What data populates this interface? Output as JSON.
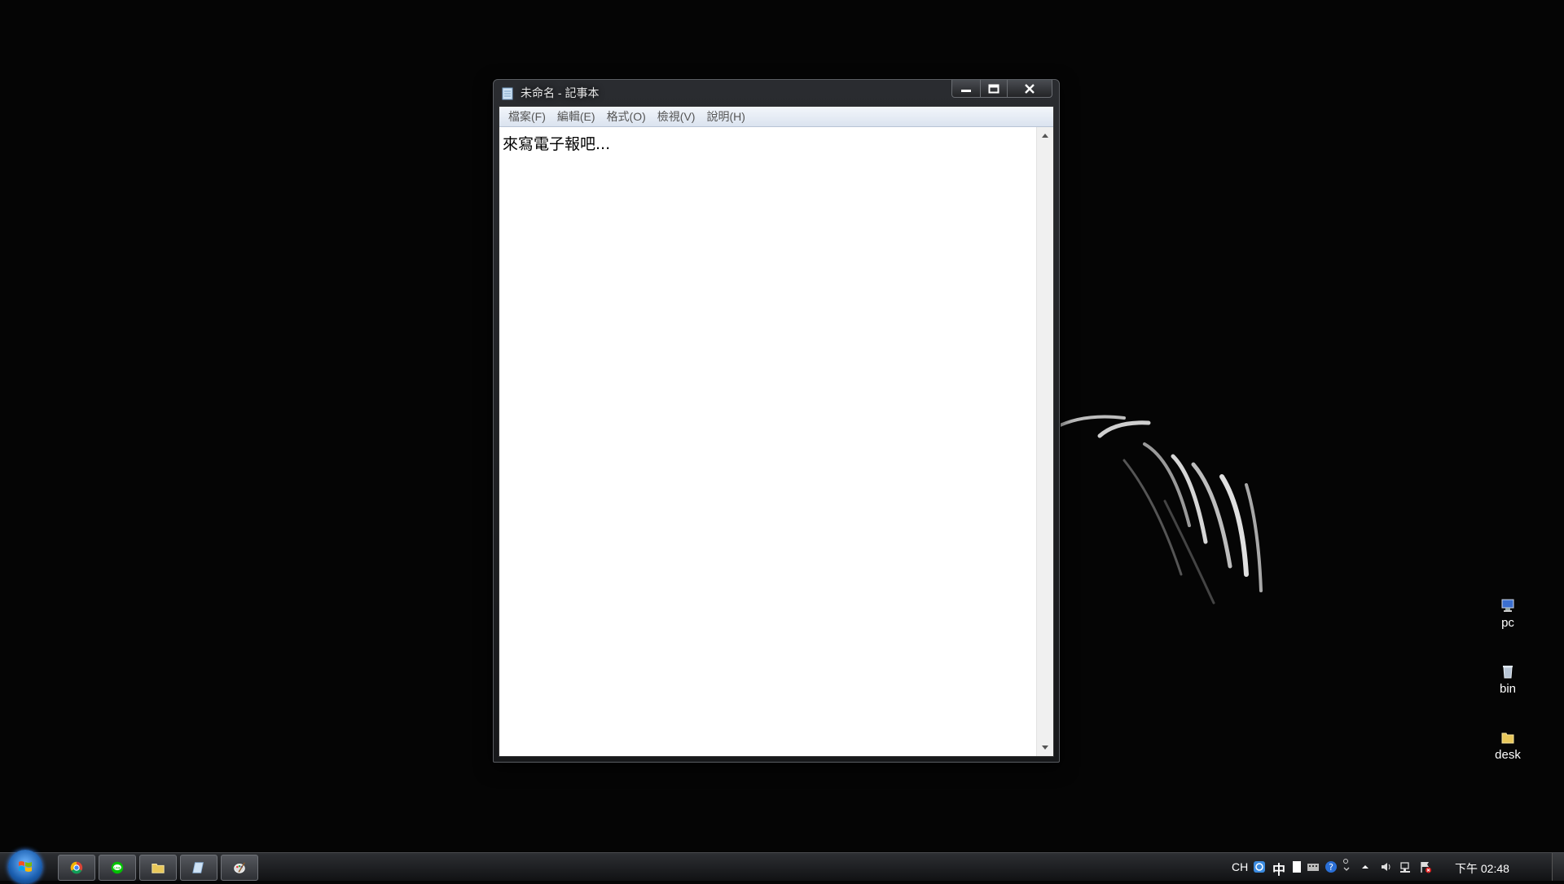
{
  "window": {
    "title": "未命名 - 記事本",
    "menu": [
      "檔案(F)",
      "編輯(E)",
      "格式(O)",
      "檢視(V)",
      "說明(H)"
    ],
    "content": "來寫電子報吧..."
  },
  "desktop_icons": [
    {
      "label": "pc",
      "icon": "computer-icon"
    },
    {
      "label": "bin",
      "icon": "recycle-bin-icon"
    },
    {
      "label": "desk",
      "icon": "folder-icon"
    }
  ],
  "taskbar": {
    "pinned": [
      {
        "name": "chrome",
        "icon": "chrome-icon"
      },
      {
        "name": "line",
        "icon": "line-chat-icon"
      },
      {
        "name": "explorer",
        "icon": "folder-icon"
      },
      {
        "name": "notepad",
        "icon": "notepad-icon"
      },
      {
        "name": "paint",
        "icon": "paint-icon"
      }
    ],
    "tray": {
      "language": "CH",
      "ime_mode": "中",
      "clock": "下午 02:48"
    }
  },
  "colors": {
    "desktop_bg": "#050505",
    "menubar": "#dbe3ef",
    "start_orb": "#1b5fb0"
  }
}
